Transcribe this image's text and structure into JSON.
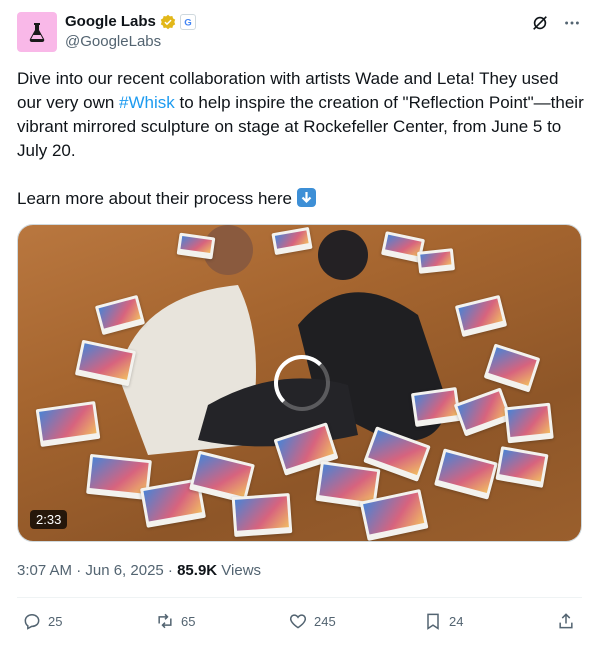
{
  "author": {
    "display_name": "Google Labs",
    "handle": "@GoogleLabs"
  },
  "tweet": {
    "text_before_hashtag": "Dive into our recent collaboration with artists Wade and Leta! They used our very own ",
    "hashtag": "#Whisk",
    "text_after_hashtag": " to help inspire the creation of \"Reflection Point\"—their vibrant mirrored sculpture on stage at Rockefeller Center, from June 5 to July 20.",
    "learn_more": "Learn more about their process here "
  },
  "media": {
    "duration": "2:33"
  },
  "meta": {
    "timestamp": "3:07 AM · Jun 6, 2025 · ",
    "views_count": "85.9K",
    "views_label": " Views"
  },
  "actions": {
    "replies": "25",
    "reposts": "65",
    "likes": "245",
    "bookmarks": "24"
  },
  "colors": {
    "accent": "#1d9bf0",
    "avatar_bg": "#f9b8e8",
    "verified_gold": "#e2b719"
  }
}
